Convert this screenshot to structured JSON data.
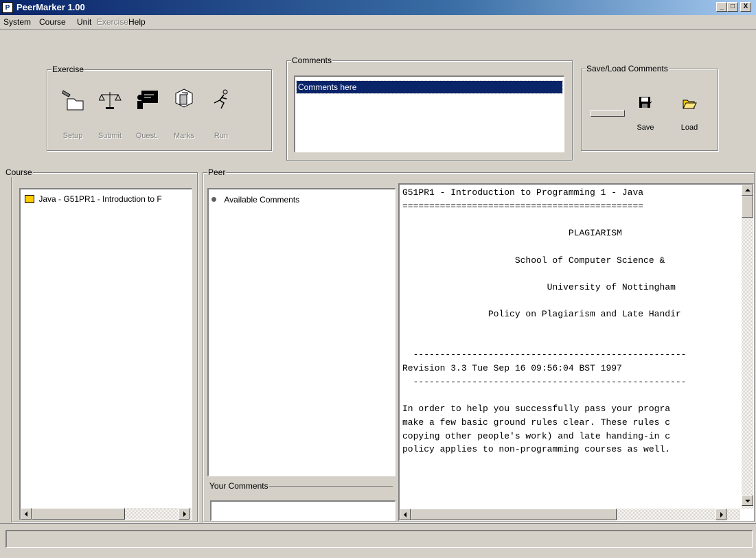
{
  "window": {
    "title": "PeerMarker 1.00",
    "icon_text": "P",
    "min": "_",
    "max": "□",
    "close": "X"
  },
  "menu": [
    {
      "label": "System",
      "enabled": true
    },
    {
      "label": "Course",
      "enabled": true
    },
    {
      "label": "Unit",
      "enabled": true
    },
    {
      "label": "Exercise",
      "enabled": false
    },
    {
      "label": "Help",
      "enabled": true
    }
  ],
  "exercise": {
    "title": "Exercise",
    "buttons": [
      {
        "label": "Setup",
        "icon": "folder-hand-icon"
      },
      {
        "label": "Submit",
        "icon": "scales-icon"
      },
      {
        "label": "Quest.",
        "icon": "teacher-board-icon"
      },
      {
        "label": "Marks",
        "icon": "cubes-icon"
      },
      {
        "label": "Run",
        "icon": "runner-icon"
      }
    ]
  },
  "comments": {
    "title": "Comments",
    "selected_item": "Comments here"
  },
  "save_load": {
    "title": "Save/Load Comments",
    "save_label": "Save",
    "load_label": "Load",
    "save_icon": "floppy-save-icon",
    "load_icon": "open-folder-icon"
  },
  "course": {
    "title": "Course",
    "item": "Java - G51PR1 - Introduction to F",
    "item_icon": "course-folder-icon"
  },
  "peer": {
    "title": "Peer",
    "item": "Available Comments",
    "your_comments_title": "Your Comments"
  },
  "document": {
    "lines": [
      "G51PR1 - Introduction to Programming 1 - Java",
      "=============================================",
      "",
      "                               PLAGIARISM",
      "",
      "                     School of Computer Science &",
      "",
      "                           University of Nottingham",
      "",
      "                Policy on Plagiarism and Late Handir",
      "",
      "",
      "  ---------------------------------------------------",
      "Revision 3.3 Tue Sep 16 09:56:04 BST 1997",
      "  ---------------------------------------------------",
      "",
      "In order to help you successfully pass your progra",
      "make a few basic ground rules clear. These rules c",
      "copying other people's work) and late handing-in c",
      "policy applies to non-programming courses as well."
    ]
  }
}
